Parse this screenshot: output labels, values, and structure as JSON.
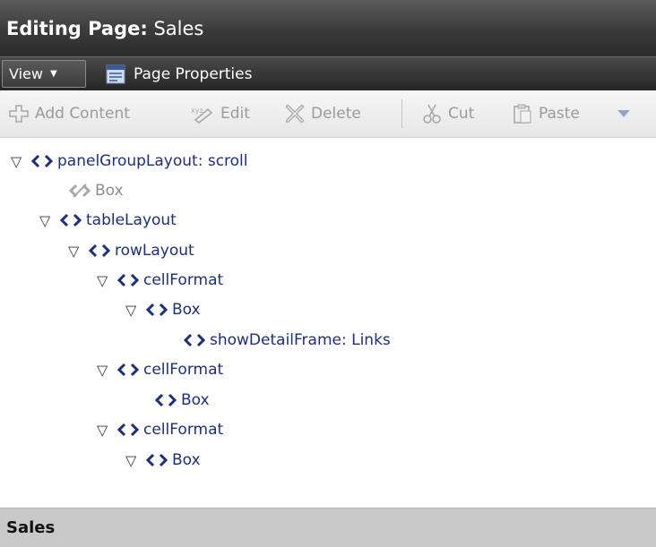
{
  "header": {
    "title_prefix": "Editing Page:",
    "title_page": " Sales",
    "view_label": "View",
    "page_properties_label": "Page Properties"
  },
  "toolbar": {
    "add_content": "Add Content",
    "edit": "Edit",
    "delete": "Delete",
    "cut": "Cut",
    "paste": "Paste"
  },
  "tree": {
    "nodes": [
      {
        "label": "panelGroupLayout: scroll",
        "expanded": true,
        "depth": 0
      },
      {
        "label": "Box",
        "depth": 1,
        "hidden": true
      },
      {
        "label": "tableLayout",
        "expanded": true,
        "depth": 1
      },
      {
        "label": "rowLayout",
        "expanded": true,
        "depth": 2
      },
      {
        "label": "cellFormat",
        "expanded": true,
        "depth": 3
      },
      {
        "label": "Box",
        "expanded": true,
        "depth": 4
      },
      {
        "label": "showDetailFrame: Links",
        "depth": 5
      },
      {
        "label": "cellFormat",
        "expanded": true,
        "depth": 3
      },
      {
        "label": "Box",
        "depth": 4
      },
      {
        "label": "cellFormat",
        "expanded": true,
        "depth": 3
      },
      {
        "label": "Box",
        "expanded": true,
        "depth": 4
      }
    ]
  },
  "footer": {
    "label": "Sales"
  },
  "icons": {
    "view_caret": "chevron-down-icon",
    "page_properties": "page-properties-icon",
    "add_content": "add-content-icon",
    "edit": "edit-icon",
    "delete": "delete-icon",
    "cut": "scissors-icon",
    "paste": "clipboard-icon",
    "more": "chevron-down-icon",
    "expand": "expand-triangle-icon",
    "component": "code-icon"
  },
  "colors": {
    "tree_text": "#1c2e84",
    "toolbar_disabled": "#9b9b9b",
    "header_bg": "#3a3a3a",
    "footer_bg": "#c9c9c9"
  }
}
